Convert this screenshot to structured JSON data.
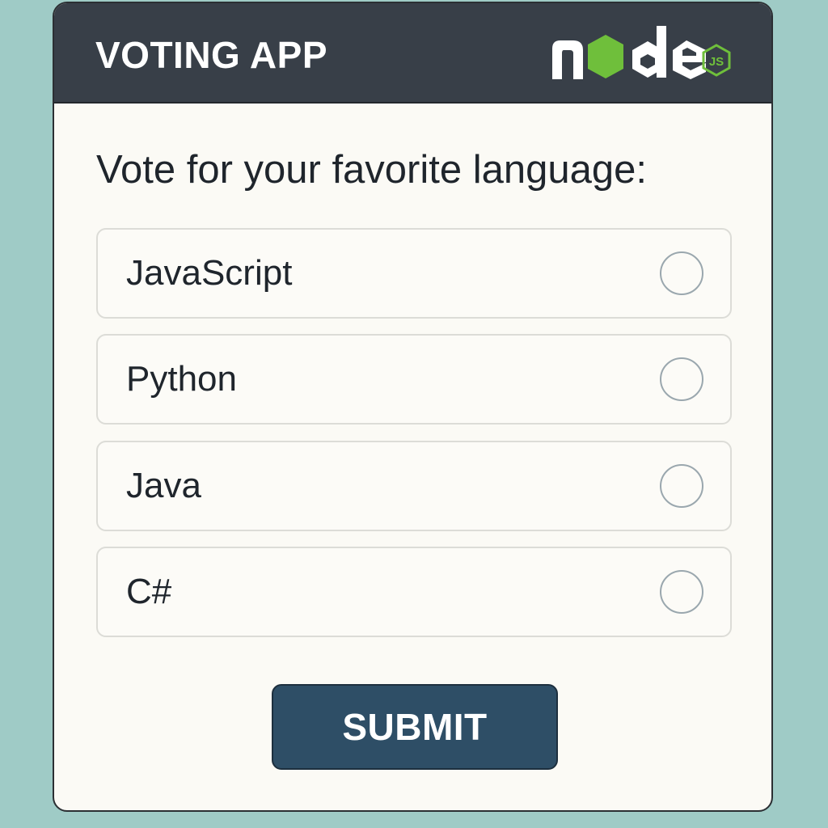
{
  "header": {
    "title": "VOTING APP",
    "logo_icon": "nodejs-logo-icon",
    "colors": {
      "background": "#383f48",
      "logo_text": "#ffffff",
      "logo_accent": "#6fbf3b"
    }
  },
  "poll": {
    "question": "Vote for your favorite language:",
    "options": [
      {
        "label": "JavaScript",
        "selected": false
      },
      {
        "label": "Python",
        "selected": false
      },
      {
        "label": "Java",
        "selected": false
      },
      {
        "label": "C#",
        "selected": false
      }
    ]
  },
  "actions": {
    "submit_label": "SUBMIT"
  },
  "colors": {
    "page_background": "#9fcbc6",
    "card_background": "#fbfaf5",
    "submit_background": "#2e4e66",
    "radio_border": "#9aa7ae"
  }
}
